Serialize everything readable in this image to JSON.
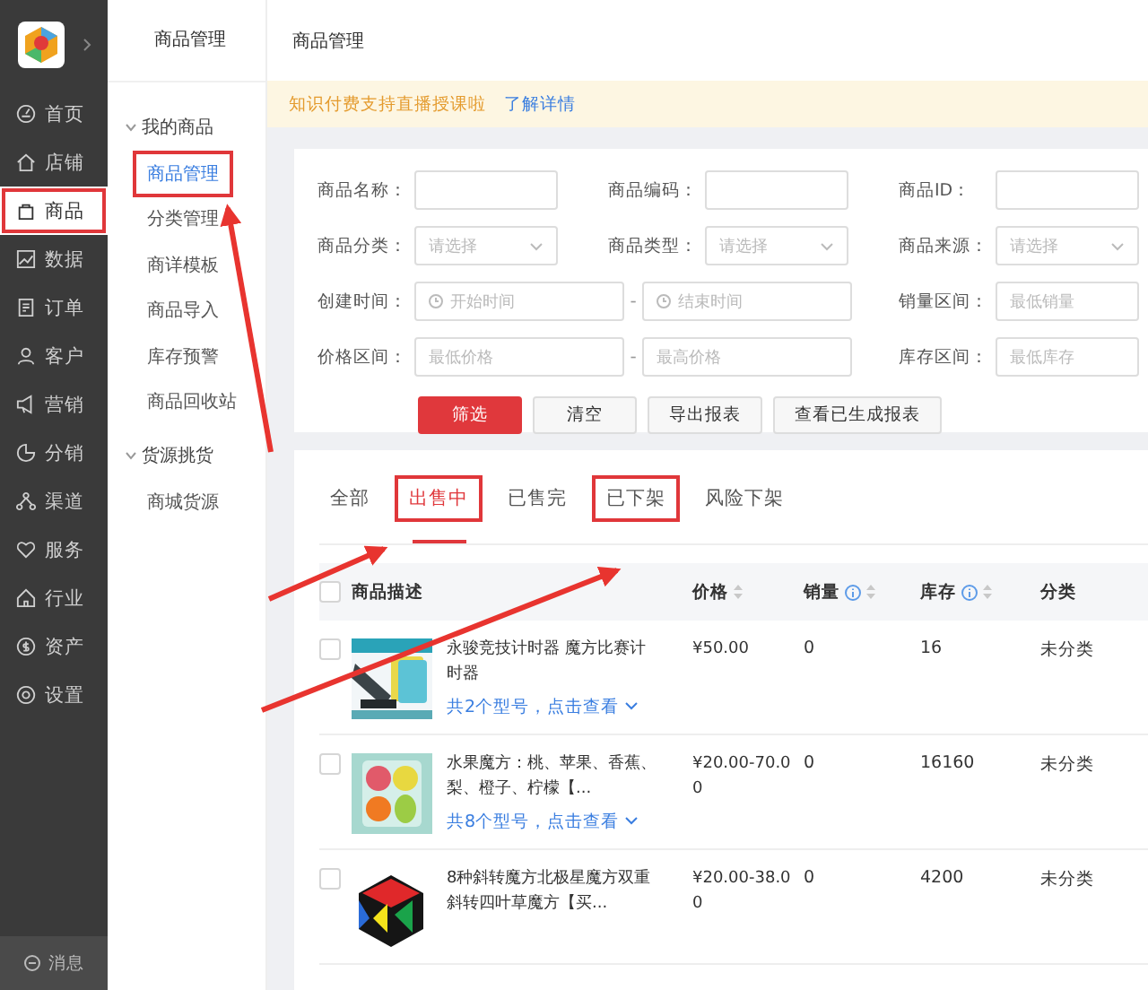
{
  "sidebar": {
    "items": [
      {
        "label": "首页",
        "selected": false,
        "annotated": false
      },
      {
        "label": "店铺",
        "selected": false,
        "annotated": false
      },
      {
        "label": "商品",
        "selected": true,
        "annotated": true
      },
      {
        "label": "数据",
        "selected": false,
        "annotated": false
      },
      {
        "label": "订单",
        "selected": false,
        "annotated": false
      },
      {
        "label": "客户",
        "selected": false,
        "annotated": false
      },
      {
        "label": "营销",
        "selected": false,
        "annotated": false
      },
      {
        "label": "分销",
        "selected": false,
        "annotated": false
      },
      {
        "label": "渠道",
        "selected": false,
        "annotated": false
      },
      {
        "label": "服务",
        "selected": false,
        "annotated": false
      },
      {
        "label": "行业",
        "selected": false,
        "annotated": false
      },
      {
        "label": "资产",
        "selected": false,
        "annotated": false
      },
      {
        "label": "设置",
        "selected": false,
        "annotated": false
      }
    ],
    "footer": "消息"
  },
  "subnav": {
    "title": "商品管理",
    "groups": [
      {
        "label": "我的商品",
        "expanded": true,
        "children": [
          {
            "label": "商品管理",
            "selected": true,
            "annotated": true
          },
          {
            "label": "分类管理",
            "selected": false,
            "annotated": false
          },
          {
            "label": "商详模板",
            "selected": false,
            "annotated": false
          },
          {
            "label": "商品导入",
            "selected": false,
            "annotated": false
          },
          {
            "label": "库存预警",
            "selected": false,
            "annotated": false
          },
          {
            "label": "商品回收站",
            "selected": false,
            "annotated": false
          }
        ]
      },
      {
        "label": "货源挑货",
        "expanded": true,
        "children": [
          {
            "label": "商城货源",
            "selected": false,
            "annotated": false
          }
        ]
      }
    ]
  },
  "header": {
    "title": "商品管理"
  },
  "notice": {
    "text": "知识付费支持直播授课啦",
    "link": "了解详情"
  },
  "filters": {
    "rows": [
      [
        {
          "kind": "text",
          "label": "商品名称："
        },
        {
          "kind": "text",
          "label": "商品编码："
        },
        {
          "kind": "text",
          "label": "商品ID："
        }
      ],
      [
        {
          "kind": "select",
          "label": "商品分类：",
          "placeholder": "请选择"
        },
        {
          "kind": "select",
          "label": "商品类型：",
          "placeholder": "请选择"
        },
        {
          "kind": "select",
          "label": "商品来源：",
          "placeholder": "请选择"
        }
      ],
      [
        {
          "kind": "date-range",
          "label": "创建时间：",
          "from": "开始时间",
          "separator": "-",
          "to": "结束时间"
        },
        {
          "kind": "text",
          "label": "销量区间：",
          "placeholder": "最低销量"
        }
      ],
      [
        {
          "kind": "range",
          "label": "价格区间：",
          "from": "最低价格",
          "separator": "-",
          "to": "最高价格"
        },
        {
          "kind": "text",
          "label": "库存区间：",
          "placeholder": "最低库存"
        }
      ]
    ],
    "buttons": [
      {
        "label": "筛选",
        "kind": "primary"
      },
      {
        "label": "清空",
        "kind": "default"
      },
      {
        "label": "导出报表",
        "kind": "default"
      },
      {
        "label": "查看已生成报表",
        "kind": "default"
      }
    ]
  },
  "tabs": [
    {
      "label": "全部",
      "selected": false,
      "annotated": false
    },
    {
      "label": "出售中",
      "selected": true,
      "annotated": true
    },
    {
      "label": "已售完",
      "selected": false,
      "annotated": false
    },
    {
      "label": "已下架",
      "selected": false,
      "annotated": true
    },
    {
      "label": "风险下架",
      "selected": false,
      "annotated": false
    }
  ],
  "table": {
    "select_all": {
      "checked": false
    },
    "columns": [
      {
        "label": "商品描述",
        "sortable": false,
        "info": false
      },
      {
        "label": "价格",
        "sortable": true,
        "info": false
      },
      {
        "label": "销量",
        "sortable": true,
        "info": true
      },
      {
        "label": "库存",
        "sortable": true,
        "info": true
      },
      {
        "label": "分类",
        "sortable": false,
        "info": false
      }
    ],
    "rows": [
      {
        "kind": "picture",
        "title": "永骏竞技计时器 魔方比赛计时器",
        "variants": "共2个型号，点击查看",
        "price": "¥50.00",
        "sales": "0",
        "stock": "16",
        "category": "未分类",
        "checked": false
      },
      {
        "kind": "picture",
        "title": "水果魔方：桃、苹果、香蕉、梨、橙子、柠檬【...",
        "variants": "共8个型号，点击查看",
        "price": "¥20.00-70.00",
        "sales": "0",
        "stock": "16160",
        "category": "未分类",
        "checked": false
      },
      {
        "kind": "picture",
        "title": "8种斜转魔方北极星魔方双重斜转四叶草魔方【买...",
        "price": "¥20.00-38.00",
        "sales": "0",
        "stock": "4200",
        "category": "未分类",
        "checked": false
      }
    ]
  }
}
